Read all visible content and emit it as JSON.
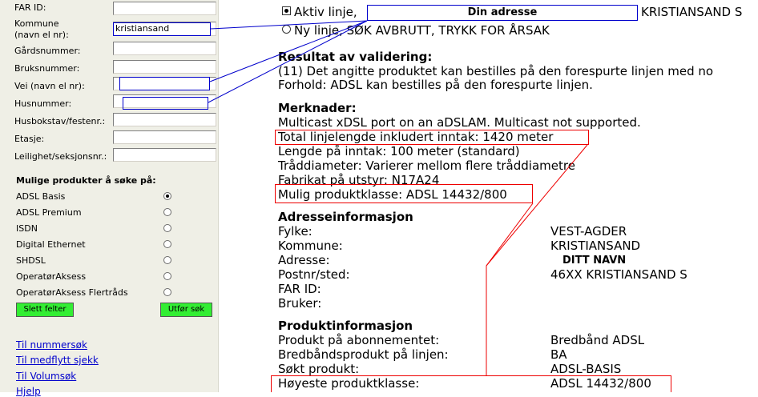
{
  "form": {
    "fields": [
      {
        "label": "FAR ID:",
        "value": ""
      },
      {
        "label": "Kommune",
        "label2": "(navn el nr):",
        "value": "kristiansand"
      },
      {
        "label": "Gårdsnummer:",
        "value": ""
      },
      {
        "label": "Bruksnummer:",
        "value": ""
      },
      {
        "label": "Vei (navn el nr):",
        "value": ""
      },
      {
        "label": "Husnummer:",
        "value": ""
      },
      {
        "label": "Husbokstav/festenr.:",
        "value": ""
      },
      {
        "label": "Etasje:",
        "value": ""
      },
      {
        "label": "Leilighet/seksjonsnr.:",
        "value": ""
      }
    ],
    "products_heading": "Mulige produkter å søke på:",
    "products": [
      {
        "label": "ADSL Basis",
        "selected": true
      },
      {
        "label": "ADSL Premium",
        "selected": false
      },
      {
        "label": "ISDN",
        "selected": false
      },
      {
        "label": "Digital Ethernet",
        "selected": false
      },
      {
        "label": "SHDSL",
        "selected": false
      },
      {
        "label": "OperatørAksess",
        "selected": false
      },
      {
        "label": "OperatørAksess Flertråds",
        "selected": false
      }
    ],
    "clear_button": "Slett felter",
    "search_button": "Utfør søk",
    "links": [
      "Til nummersøk",
      "Til medflytt sjekk",
      "Til Volumsøk",
      "Hjelp"
    ]
  },
  "result": {
    "option_active_label": "Aktiv linje,",
    "address_placeholder": "Din adresse",
    "address_city": "KRISTIANSAND S",
    "option_new_label": "Ny linje, SØK AVBRUTT, TRYKK FOR ÅRSAK",
    "validation_heading": "Resultat av validering:",
    "validation_lines": [
      "(11) Det angitte produktet kan bestilles på den forespurte linjen med no",
      "Forhold: ADSL kan bestilles på den forespurte linjen."
    ],
    "remarks_heading": "Merknader:",
    "remarks": [
      "Multicast xDSL port on an aDSLAM. Multicast not supported.",
      "Total linjelengde inkludert inntak: 1420 meter",
      "Lengde på inntak: 100 meter (standard)",
      "Tråddiameter: Varierer mellom flere tråddiametre",
      "Fabrikat på utstyr: N17A24",
      "Mulig produktklasse: ADSL 14432/800"
    ],
    "address_heading": "Adresseinformasjon",
    "address_info": [
      {
        "key": "Fylke:",
        "value": "VEST-AGDER"
      },
      {
        "key": "Kommune:",
        "value": "KRISTIANSAND"
      },
      {
        "key": "Adresse:",
        "value": "DITT NAVN"
      },
      {
        "key": "Postnr/sted:",
        "value": "46XX KRISTIANSAND S"
      },
      {
        "key": "FAR ID:",
        "value": ""
      },
      {
        "key": "Bruker:",
        "value": ""
      }
    ],
    "product_heading": "Produktinformasjon",
    "product_info": [
      {
        "key": "Produkt på abonnementet:",
        "value": "Bredbånd ADSL"
      },
      {
        "key": "Bredbåndsprodukt på linjen:",
        "value": "BA"
      },
      {
        "key": "Søkt produkt:",
        "value": "ADSL-BASIS"
      },
      {
        "key": "Høyeste produktklasse:",
        "value": "ADSL 14432/800"
      }
    ]
  },
  "colors": {
    "annotation_red": "#ee0000",
    "annotation_blue": "#0000cc",
    "button_green": "#33ee33",
    "sidebar_bg": "#efefe6",
    "link_blue": "#0000cc"
  }
}
